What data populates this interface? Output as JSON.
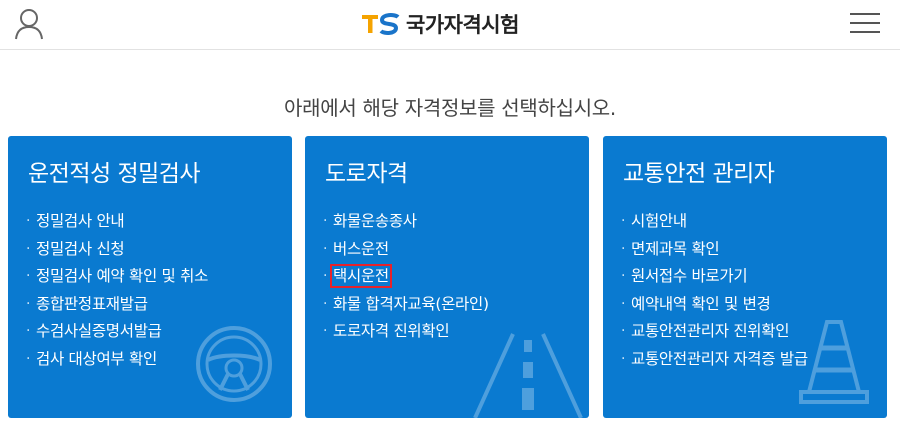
{
  "header": {
    "logo_mark": "TS",
    "logo_text": "국가자격시험",
    "user_icon": "user-icon",
    "menu_icon": "hamburger-menu-icon"
  },
  "subtitle": "아래에서 해당 자격정보를 선택하십시오.",
  "cards": [
    {
      "title": "운전적성 정밀검사",
      "items": [
        "정밀검사 안내",
        "정밀검사 신청",
        "정밀검사 예약 확인 및 취소",
        "종합판정표재발급",
        "수검사실증명서발급",
        "검사 대상여부 확인"
      ],
      "icon": "steering-wheel-icon"
    },
    {
      "title": "도로자격",
      "items": [
        "화물운송종사",
        "버스운전",
        "택시운전",
        "화물 합격자교육(온라인)",
        "도로자격 진위확인"
      ],
      "icon": "road-icon",
      "highlighted_item": "택시운전"
    },
    {
      "title": "교통안전 관리자",
      "items": [
        "시험안내",
        "면제과목 확인",
        "원서접수 바로가기",
        "예약내역 확인 및 변경",
        "교통안전관리자 진위확인",
        "교통안전관리자 자격증 발급"
      ],
      "icon": "traffic-cone-icon"
    }
  ],
  "colors": {
    "card_bg": "#0a7ad0",
    "highlight_border": "#e8222a",
    "logo_t": "#f5a300",
    "logo_s": "#1a74c9"
  }
}
